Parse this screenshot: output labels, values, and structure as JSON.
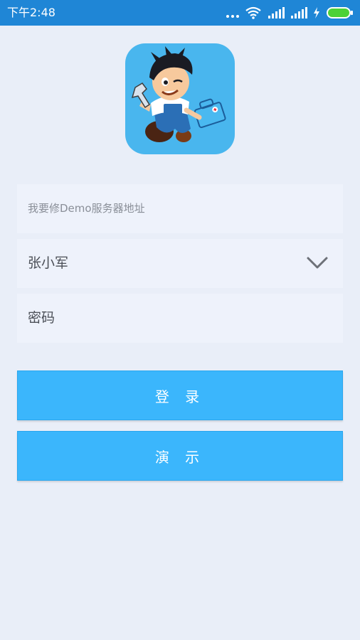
{
  "status_bar": {
    "time": "下午2:48"
  },
  "form": {
    "server_placeholder": "我要修Demo服务器地址",
    "username_value": "张小军",
    "password_placeholder": "密码"
  },
  "buttons": {
    "login": "登 录",
    "demo": "演 示"
  },
  "colors": {
    "status_bar": "#1f86d6",
    "background": "#e9eef8",
    "field": "#eef2fb",
    "button": "#3bb6fc",
    "battery": "#4cd137"
  },
  "icons": [
    "app-logo-mascot",
    "wifi-icon",
    "signal-icon",
    "charging-icon",
    "battery-icon",
    "chevron-down-icon"
  ]
}
